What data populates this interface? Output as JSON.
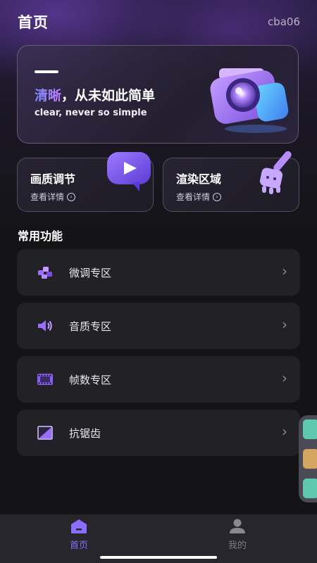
{
  "header": {
    "title": "首页",
    "user": "cba06"
  },
  "hero": {
    "headline_accent": "清晰",
    "headline_rest": "，从未如此简单",
    "subtitle": "clear, never so simple"
  },
  "cards": [
    {
      "title": "画质调节",
      "link": "查看详情"
    },
    {
      "title": "渲染区域",
      "link": "查看详情"
    }
  ],
  "section_title": "常用功能",
  "features": [
    {
      "label": "微调专区",
      "icon": "tune-icon"
    },
    {
      "label": "音质专区",
      "icon": "speaker-icon"
    },
    {
      "label": "帧数专区",
      "icon": "film-icon"
    },
    {
      "label": "抗锯齿",
      "icon": "antialias-icon"
    }
  ],
  "tabbar": [
    {
      "label": "首页",
      "icon": "home-icon",
      "active": true
    },
    {
      "label": "我的",
      "icon": "user-icon",
      "active": false
    }
  ],
  "colors": {
    "accent": "#8b6dff",
    "background": "#141417",
    "card": "#212126"
  }
}
